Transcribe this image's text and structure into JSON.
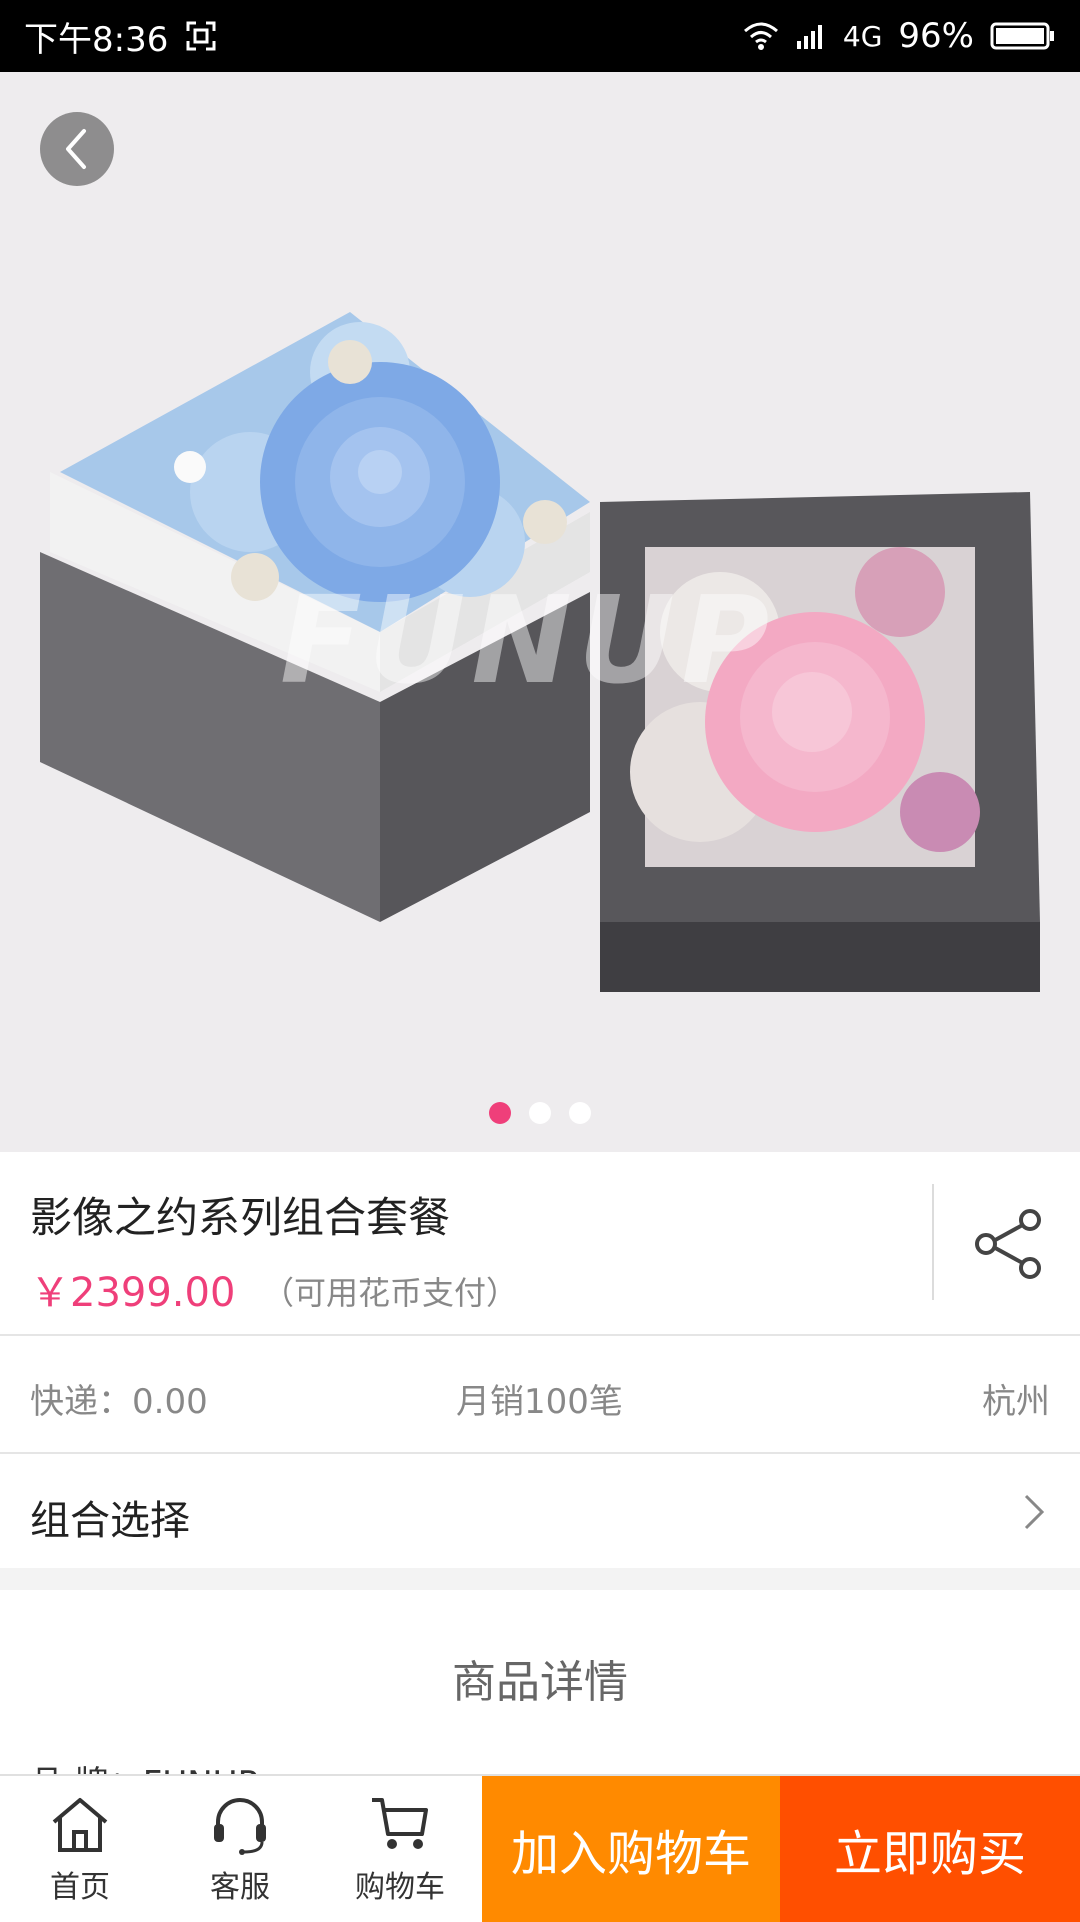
{
  "status_bar": {
    "time": "下午8:36",
    "network": "4G",
    "battery": "96%"
  },
  "hero": {
    "watermark": "FUNUP",
    "carousel_count": 3,
    "carousel_active": 1
  },
  "product": {
    "title": "影像之约系列组合套餐",
    "price": "￥2399.00",
    "payment_note": "（可用花币支付）"
  },
  "meta": {
    "shipping": "快递：0.00",
    "monthly_sales": "月销100笔",
    "location": "杭州"
  },
  "combo": {
    "label": "组合选择"
  },
  "details": {
    "title": "商品详情",
    "brand_line": "品    牌：FUNUP"
  },
  "bottom_bar": {
    "tabs": [
      {
        "label": "首页",
        "icon": "home-icon"
      },
      {
        "label": "客服",
        "icon": "headset-icon"
      },
      {
        "label": "购物车",
        "icon": "cart-icon"
      }
    ],
    "add_to_cart": "加入购物车",
    "buy_now": "立即购买"
  },
  "colors": {
    "accent_pink": "#ef3f7a",
    "cart_orange": "#ff8a00",
    "buy_orange": "#ff4f00"
  }
}
